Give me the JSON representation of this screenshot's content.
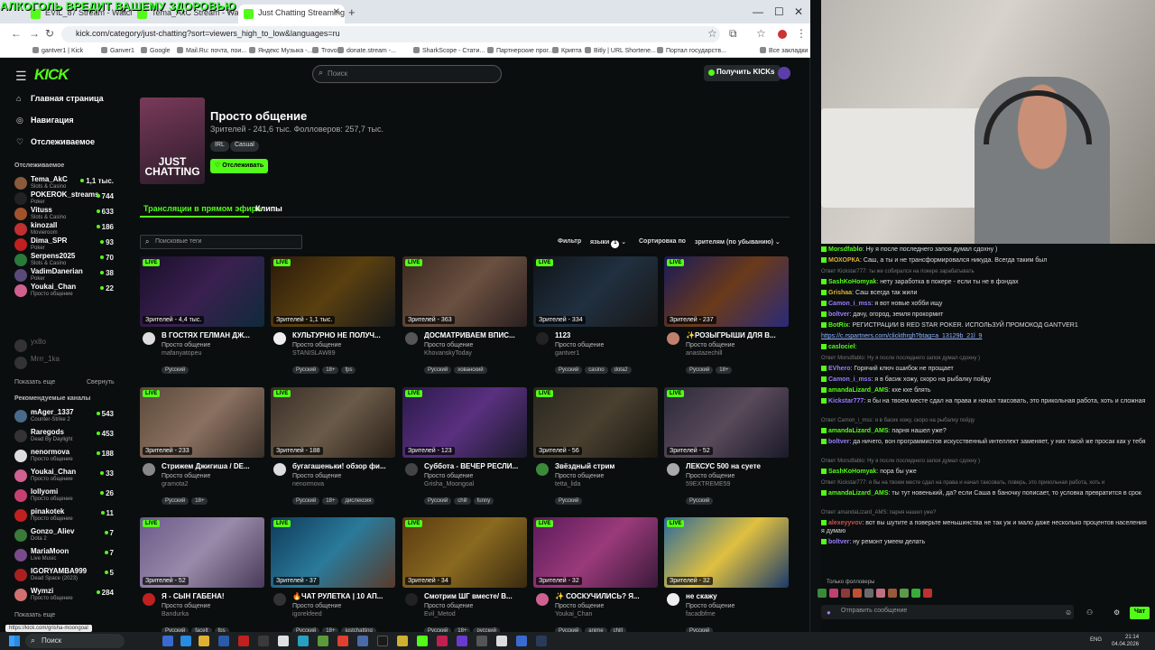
{
  "overlay_text": "АЛКОГОЛЬ ВРЕДИТ ВАШЕМУ ЗДОРОВЬЮ",
  "browser": {
    "tabs": [
      {
        "label": "EVIL_87 Stream - Watch Live on"
      },
      {
        "label": "Tema_AkC Stream - Watch Live"
      },
      {
        "label": "Just Chatting Streaming - Live"
      }
    ],
    "url": "kick.com/category/just-chatting?sort=viewers_high_to_low&languages=ru",
    "bookmarks": [
      "gantver1 | Kick",
      "Ganver1",
      "Google",
      "Mail.Ru: почта, пои...",
      "Яндекс Музыка -...",
      "Trovo",
      "donate.stream -...",
      "SharkScope - Стати...",
      "Партнерские прог...",
      "Крипта",
      "Bitly | URL Shortene...",
      "Портал государств...",
      "Все закладки"
    ]
  },
  "kick": {
    "logo": "KICK",
    "search_placeholder": "Поиск",
    "get_kicks": "Получить KICKs"
  },
  "sidebar": {
    "nav": [
      "Главная страница",
      "Навигация",
      "Отслеживаемое"
    ],
    "following_header": "Отслеживаемое",
    "following": [
      {
        "name": "Tema_AkC",
        "cat": "Slots & Casino",
        "viewers": "1,1 тыс.",
        "color": "#8a5a3c"
      },
      {
        "name": "POKEROK_streams",
        "cat": "Poker",
        "viewers": "744",
        "color": "#222"
      },
      {
        "name": "Vituss",
        "cat": "Slots & Casino",
        "viewers": "633",
        "color": "#a0522d"
      },
      {
        "name": "kinozall",
        "cat": "Movieroom",
        "viewers": "186",
        "color": "#c03030"
      },
      {
        "name": "Dima_SPR",
        "cat": "Poker",
        "viewers": "93",
        "color": "#c02020"
      },
      {
        "name": "Serpens2025",
        "cat": "Slots & Casino",
        "viewers": "70",
        "color": "#2a7a3a"
      },
      {
        "name": "VadimDanerian",
        "cat": "Poker",
        "viewers": "38",
        "color": "#5a4a7a"
      },
      {
        "name": "Youkai_Chan",
        "cat": "Просто общение",
        "viewers": "22",
        "color": "#d06090"
      }
    ],
    "offline": [
      "yx8o",
      "Mrrr_1ka"
    ],
    "show_more": "Показать еще",
    "collapse": "Свернуть",
    "recommended_header": "Рекомендуемые каналы",
    "recommended": [
      {
        "name": "mAger_1337",
        "cat": "Counter-Strike 2",
        "viewers": "543",
        "color": "#4a6a8a"
      },
      {
        "name": "Raregods",
        "cat": "Dead By Daylight",
        "viewers": "453",
        "color": "#333"
      },
      {
        "name": "nenormova",
        "cat": "Просто общение",
        "viewers": "188",
        "color": "#ddd"
      },
      {
        "name": "Youkai_Chan",
        "cat": "Просто общение",
        "viewers": "33",
        "color": "#d06090"
      },
      {
        "name": "lollyomi",
        "cat": "Просто общение",
        "viewers": "26",
        "color": "#c84070"
      },
      {
        "name": "pinakotek",
        "cat": "Просто общение",
        "viewers": "11",
        "color": "#c02020"
      },
      {
        "name": "Gonzo_Aliev",
        "cat": "Dota 2",
        "viewers": "7",
        "color": "#3a7a3a"
      },
      {
        "name": "MariaMoon",
        "cat": "Live Music",
        "viewers": "7",
        "color": "#7a4a8a"
      },
      {
        "name": "IGORYAMBA999",
        "cat": "Dead Space (2023)",
        "viewers": "5",
        "color": "#aa2020"
      },
      {
        "name": "Wymzi",
        "cat": "Просто общение",
        "viewers": "284",
        "color": "#d07070"
      }
    ]
  },
  "category": {
    "title": "Просто общение",
    "stats": "Зрителей - 241,6 тыс.  Фолловеров: 257,7 тыс.",
    "tags": [
      "IRL",
      "Casual"
    ],
    "follow_button": "Отслеживать",
    "image_text": "JUST CHATTING"
  },
  "tabs": {
    "live": "Трансляции в прямом эфире",
    "clips": "Клипы"
  },
  "filters": {
    "tag_search_placeholder": "Поисковые теги",
    "filter_label": "Фильтр",
    "languages": "языки",
    "languages_count": "1",
    "sort_label": "Сортировка по",
    "sort_value": "зрителям (по убыванию)"
  },
  "live_badge": "LIVE",
  "streams": [
    {
      "viewers": "Зрителей - 4,4 тыс.",
      "title": "В ГОСТЯХ ГЕЛМАН ДЖ...",
      "cat": "Просто общение",
      "user": "mafanyatopeu",
      "tags": [
        "Русский"
      ],
      "bg": "linear-gradient(135deg,#1a0f2a,#3a2050,#0f2a3a)",
      "av": "#ddd"
    },
    {
      "viewers": "Зрителей - 1,1 тыс.",
      "title": "КУЛЬТУРНО НЕ ПОЛУЧ...",
      "cat": "Просто общение",
      "user": "STANISLAW89",
      "tags": [
        "Русский",
        "18+",
        "fps"
      ],
      "bg": "linear-gradient(135deg,#2a1a0a,#5a4010,#1a1a1a)",
      "av": "#eee"
    },
    {
      "viewers": "Зрителей - 363",
      "title": "ДОСМАТРИВАЕМ ВПИС...",
      "cat": "Просто общение",
      "user": "KhovanskyToday",
      "tags": [
        "Русский",
        "хованский"
      ],
      "bg": "linear-gradient(135deg,#3a2a20,#6a5040,#2a2020)",
      "av": "#555"
    },
    {
      "viewers": "Зрителей - 334",
      "title": "1123",
      "cat": "Просто общение",
      "user": "gantver1",
      "tags": [
        "Русский",
        "casino",
        "dota2"
      ],
      "bg": "linear-gradient(135deg,#101418,#203040,#181818)",
      "av": "#222"
    },
    {
      "viewers": "Зрителей - 237",
      "title": "✨РОЗЫГРЫШИ ДЛЯ В...",
      "cat": "Просто общение",
      "user": "anastazechill",
      "tags": [
        "Русский",
        "18+"
      ],
      "bg": "linear-gradient(135deg,#1a1a5a,#6a3a1a,#2a2a7a)",
      "av": "#c08070"
    },
    {
      "viewers": "Зрителей - 233",
      "title": "Стрижем Джигиша / DE...",
      "cat": "Просто общение",
      "user": "gramota2",
      "tags": [
        "Русский",
        "18+"
      ],
      "bg": "linear-gradient(135deg,#5a4a3a,#8a7060,#3a3028)",
      "av": "#888"
    },
    {
      "viewers": "Зрителей - 188",
      "title": "бугагашеньки! обзор фи...",
      "cat": "Просто общение",
      "user": "nenormova",
      "tags": [
        "Русский",
        "18+",
        "дислексия"
      ],
      "bg": "linear-gradient(135deg,#3a3028,#6a5a48,#2a2018)",
      "av": "#ddd"
    },
    {
      "viewers": "Зрителей - 123",
      "title": "Суббота - ВЕЧЕР РЕСЛИ...",
      "cat": "Просто общение",
      "user": "Grisha_Moongoal",
      "tags": [
        "Русский",
        "chill",
        "funny"
      ],
      "bg": "linear-gradient(135deg,#2a1a4a,#5a3080,#1a1a2a)",
      "av": "#444"
    },
    {
      "viewers": "Зрителей - 56",
      "title": "Звёздный стрим",
      "cat": "Просто общение",
      "user": "tetta_lida",
      "tags": [
        "Русский"
      ],
      "bg": "linear-gradient(135deg,#2a2820,#4a4030,#1a1810)",
      "av": "#3a8a3a"
    },
    {
      "viewers": "Зрителей - 52",
      "title": "ЛЕКСУС 500 на суете",
      "cat": "Просто общение",
      "user": "59EXTREME59",
      "tags": [
        "Русский"
      ],
      "bg": "linear-gradient(135deg,#2a2a3a,#5a4a5a,#1a1a2a)",
      "av": "#aaa"
    },
    {
      "viewers": "Зрителей - 52",
      "title": "Я - СЫН ГАБЕНА!",
      "cat": "Просто общение",
      "user": "Bandurka",
      "tags": [
        "Русский",
        "facelt",
        "fps"
      ],
      "bg": "linear-gradient(135deg,#6a5a8a,#9a8aaa,#4a3a5a)",
      "av": "#c02020"
    },
    {
      "viewers": "Зрителей - 37",
      "title": "🔥ЧАТ РУЛЕТКА | 10 АП...",
      "cat": "Просто общение",
      "user": "igorekfeed",
      "tags": [
        "Русский",
        "18+",
        "justchatting"
      ],
      "bg": "linear-gradient(135deg,#103a5a,#2a7a9a,#5a3a2a)",
      "av": "#333"
    },
    {
      "viewers": "Зрителей - 34",
      "title": "Смотрим ШГ вместе/ В...",
      "cat": "Просто общение",
      "user": "Evil_Metod",
      "tags": [
        "Русский",
        "18+",
        "русский"
      ],
      "bg": "linear-gradient(135deg,#5a3a10,#8a6a20,#3a2a10)",
      "av": "#222"
    },
    {
      "viewers": "Зрителей - 32",
      "title": "✨ СОСКУЧИЛИСЬ? Я...",
      "cat": "Просто общение",
      "user": "Youkai_Chan",
      "tags": [
        "Русский",
        "anime",
        "chill"
      ],
      "bg": "linear-gradient(135deg,#5a1a5a,#9a3a7a,#3a1a3a)",
      "av": "#d06090"
    },
    {
      "viewers": "Зрителей - 32",
      "title": "не скажу",
      "cat": "Просто общение",
      "user": "facadbfme",
      "tags": [
        "Русский"
      ],
      "bg": "linear-gradient(135deg,#2a6a9a,#e0c040,#1a3a6a)",
      "av": "#eee"
    }
  ],
  "status_url": "https://kick.com/grisha-moongoal",
  "chat": {
    "messages": [
      {
        "reply": "",
        "user": "Morsdfablo",
        "color": "#53fc18",
        "text": "Ну я после последнего запоя думал сдохну )"
      },
      {
        "reply": "",
        "user": "МОХОРКА",
        "color": "#e0b030",
        "text": "Саш, а ты и не трансформировался никуда. Всегда таким был"
      },
      {
        "reply": "Ответ Kickstar777: ты же собирался на покере зарабатывать",
        "user": "",
        "color": "",
        "text": ""
      },
      {
        "reply": "",
        "user": "SashKoHomyak",
        "color": "#53fc18",
        "text": "нету заработка в покере - если ты не в фондах"
      },
      {
        "reply": "",
        "user": "Grishaa",
        "color": "#e0b030",
        "text": "Саш всегда так жили"
      },
      {
        "reply": "",
        "user": "Camon_i_mss",
        "color": "#9a7aff",
        "text": "я вот новые хобби ищу"
      },
      {
        "reply": "",
        "user": "boltver",
        "color": "#9a7aff",
        "text": "дачу, огород, земля прокормит"
      },
      {
        "reply": "",
        "user": "BotRix",
        "color": "#53fc18",
        "text": "РЕГИСТРАЦИИ В RED STAR POKER. ИСПОЛЬЗУЙ ПРОМОКОД GANTVER1"
      },
      {
        "reply": "",
        "user": "",
        "color": "",
        "text": "https://c.rspartners.com/clickthrgh?btag=a_13129b_21l_9"
      },
      {
        "reply": "",
        "user": "caslociel",
        "color": "#53fc18",
        "text": ""
      },
      {
        "reply": "Ответ Morsdfablo: Ну я после последнего запоя думал сдохну )",
        "user": "",
        "color": "",
        "text": ""
      },
      {
        "reply": "",
        "user": "EVhero",
        "color": "#9a7aff",
        "text": "Горячий ключ ошибок не прощает"
      },
      {
        "reply": "",
        "user": "Camon_i_mss",
        "color": "#9a7aff",
        "text": "я в басик хожу, скоро на рыбалку пойду"
      },
      {
        "reply": "",
        "user": "amandaLizard_AMS",
        "color": "#53fc18",
        "text": "кхе кхе блять"
      },
      {
        "reply": "",
        "user": "Kickstar777",
        "color": "#9a7aff",
        "text": "я бы на твоем месте сдал на права и начал таксовать, это прикольная работа, хоть и сложная"
      },
      {
        "reply": "Ответ Camon_i_mss: я в басик хожу, скоро на рыбалку пойду",
        "user": "",
        "color": "",
        "text": ""
      },
      {
        "reply": "",
        "user": "amandaLizard_AMS",
        "color": "#53fc18",
        "text": "парня нашел уже?"
      },
      {
        "reply": "",
        "user": "boltver",
        "color": "#9a7aff",
        "text": "да ничего, вон программистов искусственный интеллект заменяет, у них такой же просак как у тебя"
      },
      {
        "reply": "Ответ Morsdfablo: Ну я после последнего запоя думал сдохну )",
        "user": "",
        "color": "",
        "text": ""
      },
      {
        "reply": "",
        "user": "SashKoHomyak",
        "color": "#53fc18",
        "text": "пора бы уже"
      },
      {
        "reply": "Ответ Kickstar777: я бы на твоем месте сдал на права и начал таксовать, поверь, это прикольная работа, хоть и",
        "user": "",
        "color": "",
        "text": ""
      },
      {
        "reply": "",
        "user": "amandaLizard_AMS",
        "color": "#53fc18",
        "text": "ты тут новенький, да? если Саша в баночку пописает, то условка превратится в срок"
      },
      {
        "reply": "Ответ amandaLizard_AMS: парня нашел уже?",
        "user": "",
        "color": "",
        "text": ""
      },
      {
        "reply": "",
        "user": "alexeyyvov",
        "color": "#d05050",
        "text": "вот вы шутите а поверьте меньшинства не так уж и мало даже несколько процентов населения я думаю"
      },
      {
        "reply": "",
        "user": "boltver",
        "color": "#9a7aff",
        "text": "ну ремонт умеем делать"
      }
    ],
    "followers_only": "Только фолловеры",
    "input_placeholder": "Отправить сообщение",
    "send_button": "Чат"
  },
  "taskbar": {
    "search": "Поиск",
    "lang": "ENG",
    "time": "21:14",
    "date": "04.04.2026"
  }
}
